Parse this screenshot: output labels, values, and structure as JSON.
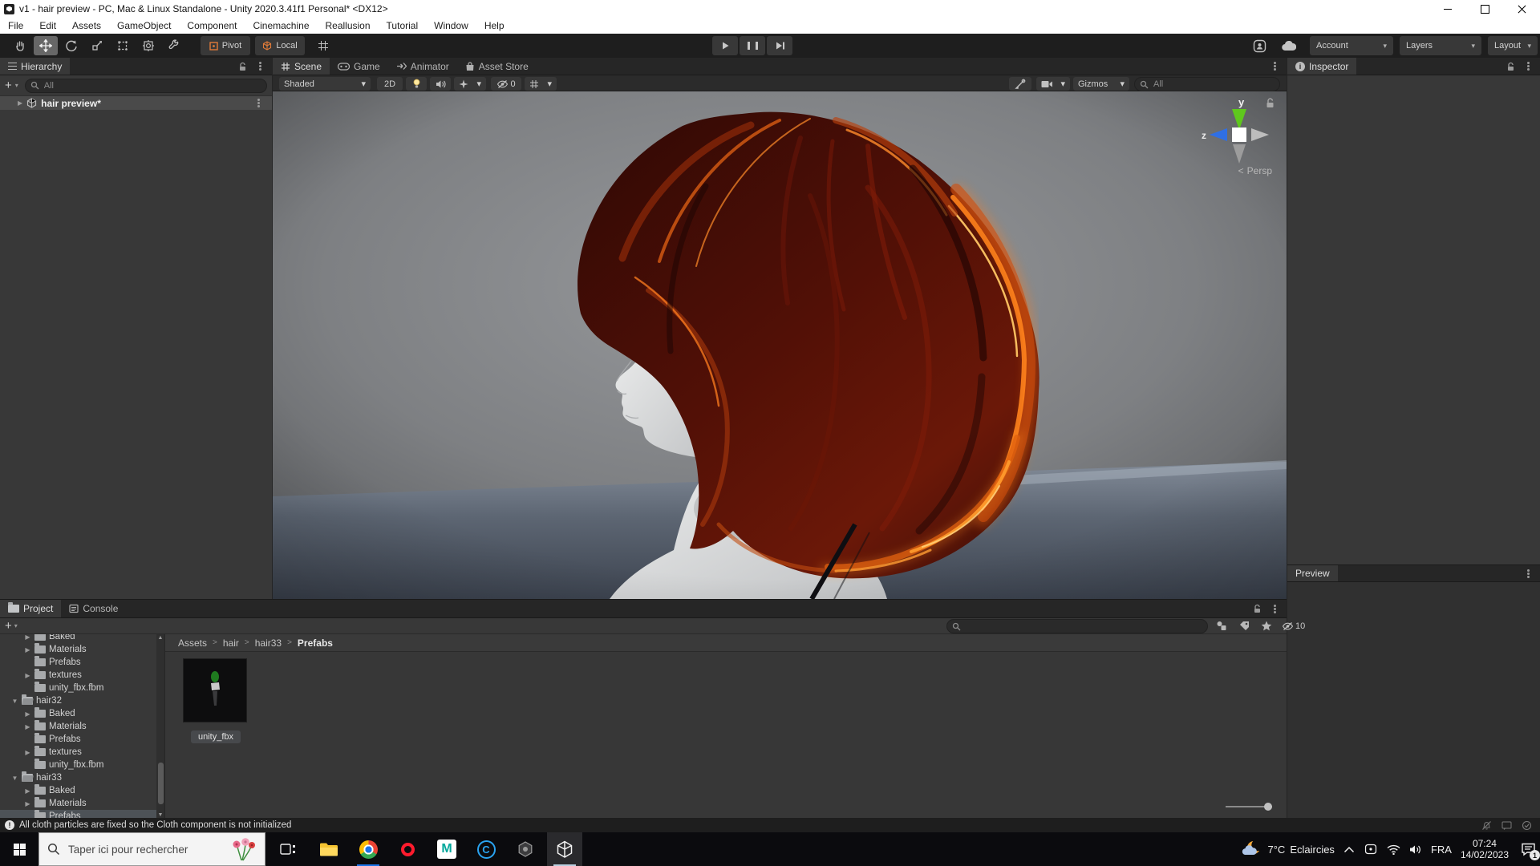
{
  "window": {
    "title": "v1 - hair preview - PC, Mac & Linux Standalone - Unity 2020.3.41f1 Personal* <DX12>",
    "menus": [
      "File",
      "Edit",
      "Assets",
      "GameObject",
      "Component",
      "Cinemachine",
      "Reallusion",
      "Tutorial",
      "Window",
      "Help"
    ]
  },
  "toolbar": {
    "pivot": "Pivot",
    "local": "Local",
    "account": "Account",
    "layers": "Layers",
    "layout": "Layout"
  },
  "glyphs": {
    "dropdown": "▾",
    "tree_closed": "▶",
    "tree_open": "▼",
    "plus": "+",
    "sep": ">",
    "persp_arrow": "<",
    "play": "▶"
  },
  "hierarchy": {
    "title": "Hierarchy",
    "search_placeholder": "All",
    "scene_row": "hair preview*"
  },
  "scene": {
    "tabs": [
      "Scene",
      "Game",
      "Animator",
      "Asset Store"
    ],
    "shading": "Shaded",
    "btn_2d": "2D",
    "hidden_count": "0",
    "gizmos": "Gizmos",
    "search_placeholder": "All",
    "axis_y": "y",
    "axis_z": "z",
    "projection": "Persp"
  },
  "inspector": {
    "title": "Inspector"
  },
  "preview": {
    "title": "Preview"
  },
  "project": {
    "tab_project": "Project",
    "tab_console": "Console",
    "search_placeholder": "",
    "hidden_count": "10",
    "breadcrumb": [
      "Assets",
      "hair",
      "hair33",
      "Prefabs"
    ],
    "tree": [
      {
        "label": "Baked"
      },
      {
        "label": "Materials"
      },
      {
        "label": "Prefabs"
      },
      {
        "label": "textures"
      },
      {
        "label": "unity_fbx.fbm"
      },
      {
        "label": "hair32"
      },
      {
        "label": "Baked"
      },
      {
        "label": "Materials"
      },
      {
        "label": "Prefabs"
      },
      {
        "label": "textures"
      },
      {
        "label": "unity_fbx.fbm"
      },
      {
        "label": "hair33"
      },
      {
        "label": "Baked"
      },
      {
        "label": "Materials"
      },
      {
        "label": "Prefabs"
      }
    ],
    "asset_name": "unity_fbx"
  },
  "statusbar": {
    "message": "All cloth particles are fixed so the Cloth component is not initialized"
  },
  "taskbar": {
    "search_placeholder": "Taper ici pour rechercher",
    "weather_temp": "7°C",
    "weather_label": "Eclaircies",
    "language": "FRA",
    "time": "07:24",
    "date": "14/02/2023",
    "badge": "1"
  },
  "icons": {
    "opera": "O",
    "m": "M",
    "c": "C"
  },
  "colors": {
    "hair_highlight": "#ff8c1f",
    "hair_base": "#4a0e07",
    "selection_gray": "#4d5257",
    "unity_panel": "#383838",
    "taskbar_black": "#0b0b0e",
    "chrome_blue": "#1a73e8"
  }
}
